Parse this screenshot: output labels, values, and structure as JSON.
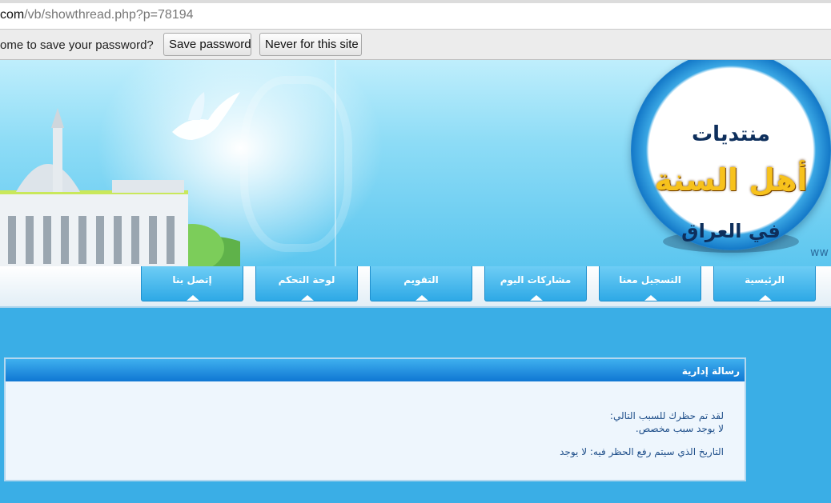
{
  "browser": {
    "url_host": "com",
    "url_rest": "/vb/showthread.php?p=78194",
    "password_prompt": "ome to save your password?",
    "save_password_label": "Save password",
    "never_label": "Never for this site"
  },
  "banner": {
    "logo_line1": "منتديات",
    "logo_line2": "أهل السنة",
    "logo_line3": "في العراق",
    "www_fragment": "ww"
  },
  "nav": {
    "items": [
      {
        "label": "الرئيسية"
      },
      {
        "label": "التسجيل معنا"
      },
      {
        "label": "مشاركات اليوم"
      },
      {
        "label": "التقويم"
      },
      {
        "label": "لوحة التحكم"
      },
      {
        "label": "إتصل بنا"
      }
    ]
  },
  "notice": {
    "title": "رسالة إدارية",
    "line1": "لقد تم حظرك للسبب التالي:",
    "line2": "لا يوجد سبب مخصص.",
    "line3": "التاريخ الذي سيتم رفع الحظر فيه: لا يوجد"
  },
  "colors": {
    "page_background": "#3aaee6",
    "tab_background": "#2ea9e6",
    "panel_header": "#0f77d3",
    "notice_text": "#1f4f8a"
  }
}
